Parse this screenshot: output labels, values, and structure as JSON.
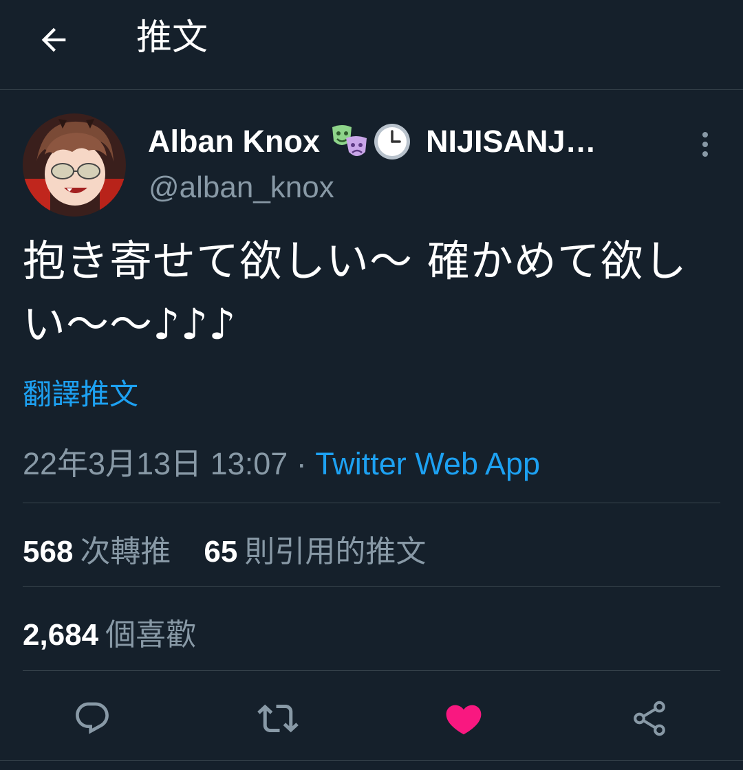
{
  "header": {
    "title": "推文",
    "back_icon": "arrow-left-icon"
  },
  "tweet": {
    "author": {
      "display_name": "Alban Knox",
      "emojis": [
        "performing-arts-icon",
        "clock-icon"
      ],
      "org_name": "NIJISANJ…",
      "handle": "@alban_knox",
      "avatar": "user-avatar"
    },
    "text": "抱き寄せて欲しい〜 確かめて欲しい〜〜♪♪♪",
    "translate_label": "翻譯推文",
    "timestamp": "22年3月13日 13:07",
    "separator": " · ",
    "source": "Twitter Web App"
  },
  "stats": {
    "retweets_count": "568",
    "retweets_label": "次轉推",
    "quotes_count": "65",
    "quotes_label": "則引用的推文",
    "likes_count": "2,684",
    "likes_label": "個喜歡"
  },
  "actions": {
    "reply_icon": "reply-icon",
    "retweet_icon": "retweet-icon",
    "like_icon": "heart-icon",
    "share_icon": "share-icon"
  },
  "colors": {
    "background": "#15202b",
    "accent": "#1da1f2",
    "secondary_text": "#8899a6",
    "divider": "#38444d",
    "like": "#f91880"
  }
}
